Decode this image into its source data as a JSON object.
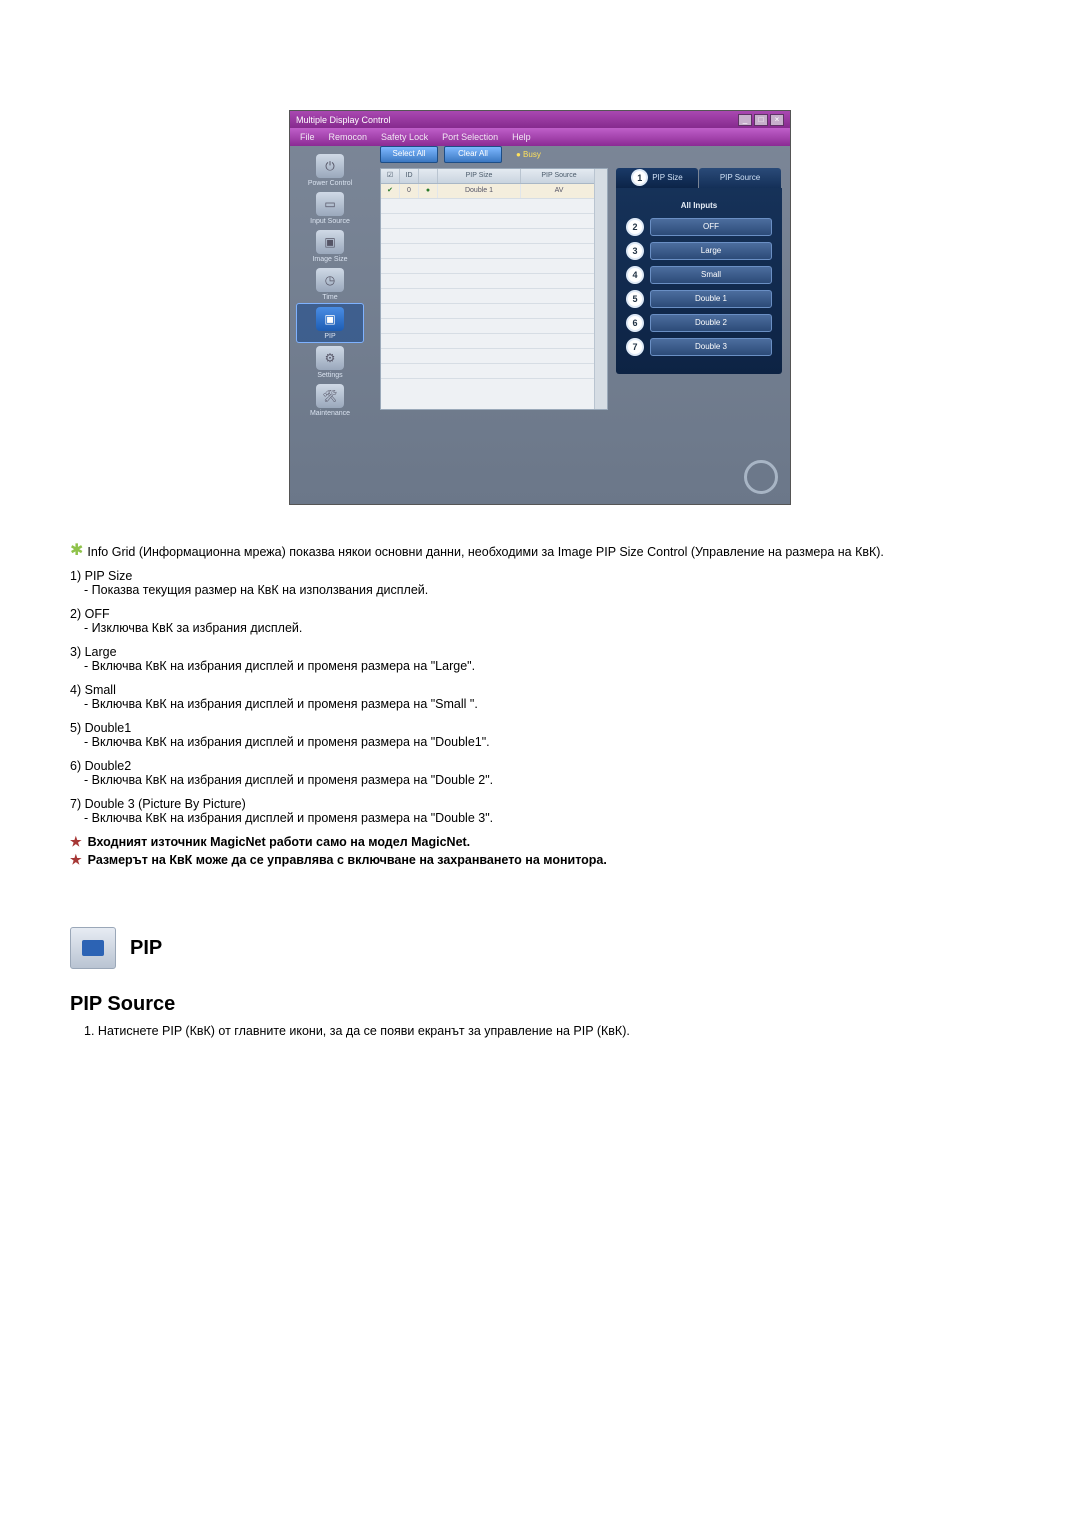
{
  "screenshot": {
    "title": "Multiple Display Control",
    "menus": [
      "File",
      "Remocon",
      "Safety Lock",
      "Port Selection",
      "Help"
    ],
    "toolbar": {
      "select_all": "Select All",
      "clear_all": "Clear All",
      "busy": "● Busy"
    },
    "sidebar": [
      {
        "label": "Power Control",
        "glyph": "⏻"
      },
      {
        "label": "Input Source",
        "glyph": "▭"
      },
      {
        "label": "Image Size",
        "glyph": "▣"
      },
      {
        "label": "Time",
        "glyph": "◷"
      },
      {
        "label": "PIP",
        "glyph": "▣"
      },
      {
        "label": "Settings",
        "glyph": "⚙"
      },
      {
        "label": "Maintenance",
        "glyph": "🛠"
      }
    ],
    "grid": {
      "cols": [
        "☑",
        "ID",
        "",
        "PIP Size",
        "PIP Source"
      ],
      "row1": [
        "✔",
        "0",
        "●",
        "Double 1",
        "AV"
      ]
    },
    "panel": {
      "tab1": "PIP Size",
      "tab2": "PIP Source",
      "tab1_num": "1",
      "title": "All Inputs",
      "options": [
        {
          "n": "2",
          "l": "OFF"
        },
        {
          "n": "3",
          "l": "Large"
        },
        {
          "n": "4",
          "l": "Small"
        },
        {
          "n": "5",
          "l": "Double 1"
        },
        {
          "n": "6",
          "l": "Double 2"
        },
        {
          "n": "7",
          "l": "Double 3"
        }
      ]
    }
  },
  "lead": "Info Grid (Информационна мрежа) показва някои основни данни, необходими за Image PIP Size Control (Управление на размера на КвК).",
  "items": [
    {
      "n": "1)",
      "t": "PIP Size",
      "d": "- Показва текущия размер на КвК на използвания дисплей."
    },
    {
      "n": "2)",
      "t": "OFF",
      "d": "- Изключва КвК за избрания дисплей."
    },
    {
      "n": "3)",
      "t": "Large",
      "d": "- Включва КвК на избрания дисплей и променя размера на \"Large\"."
    },
    {
      "n": "4)",
      "t": "Small",
      "d": "- Включва КвК на избрания дисплей и променя размера на \"Small \"."
    },
    {
      "n": "5)",
      "t": "Double1",
      "d": "- Включва КвК на избрания дисплей и променя размера на \"Double1\"."
    },
    {
      "n": "6)",
      "t": "Double2",
      "d": "- Включва КвК на избрания дисплей и променя размера на \"Double 2\"."
    },
    {
      "n": "7)",
      "t": "Double 3 (Picture By Picture)",
      "d": "- Включва КвК на избрания дисплей и променя размера на \"Double 3\"."
    }
  ],
  "notes": [
    "Входният източник MagicNet работи само на модел MagicNet.",
    "Размерът на КвК може да се управлява с включване на захранването на монитора."
  ],
  "section": {
    "title": "PIP",
    "subtitle": "PIP Source"
  },
  "steps": [
    {
      "n": "1.",
      "t": "Натиснете PIP (КвК) от главните икони, за да се появи екранът за управление на PIP (КвК)."
    }
  ]
}
